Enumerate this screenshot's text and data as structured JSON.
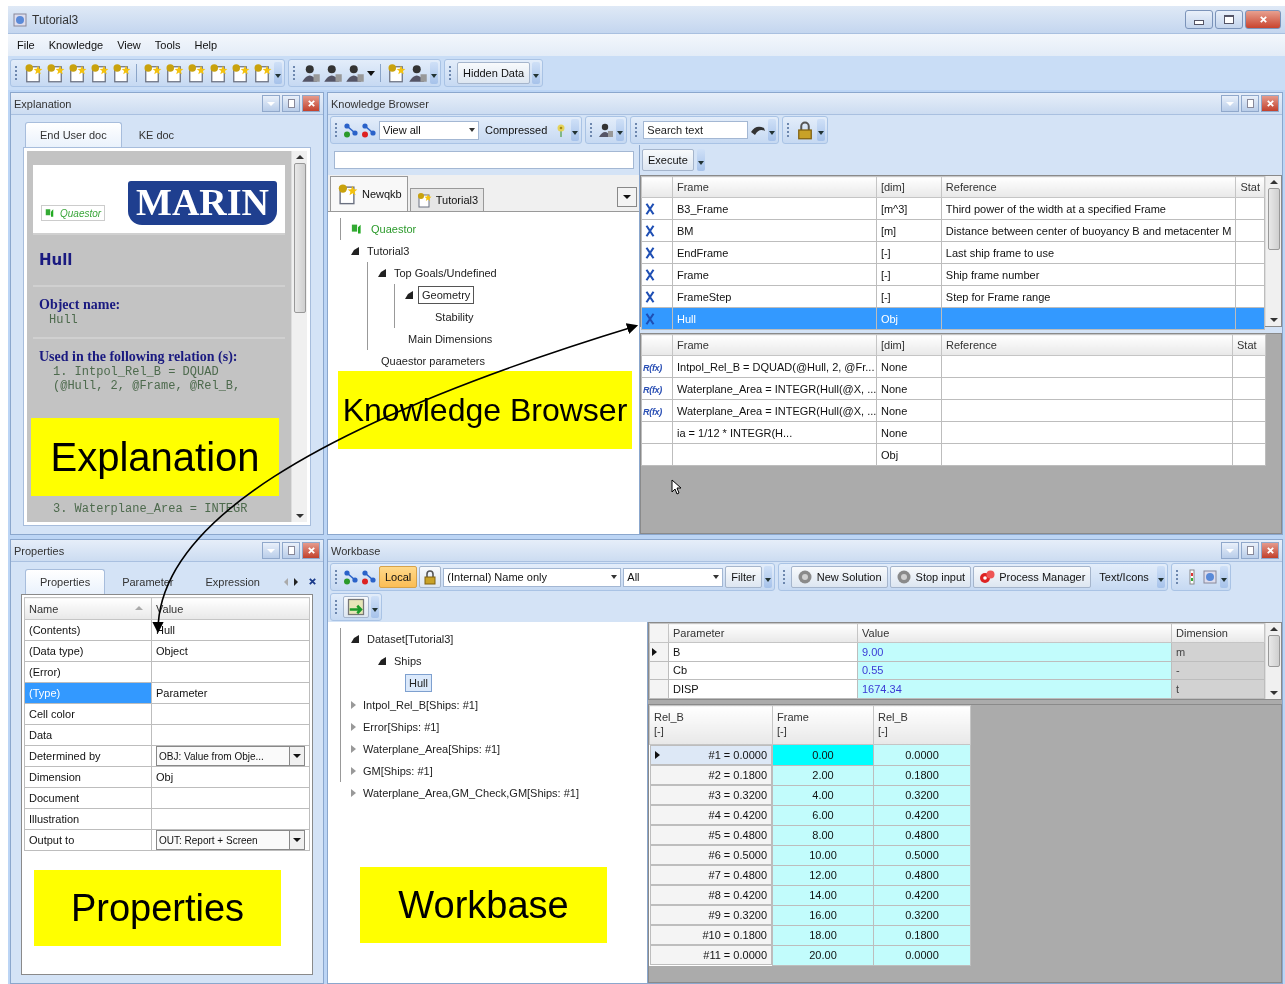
{
  "window": {
    "title": "Tutorial3"
  },
  "menu": [
    {
      "label": "File"
    },
    {
      "label": "Knowledge"
    },
    {
      "label": "View"
    },
    {
      "label": "Tools"
    },
    {
      "label": "Help"
    }
  ],
  "toolbar": {
    "hidden_data": "Hidden Data"
  },
  "explanation": {
    "title": "Explanation",
    "tabs": [
      {
        "label": "End User doc",
        "selected": true
      },
      {
        "label": "KE doc",
        "selected": false
      }
    ],
    "logo": {
      "brand": "MARIN",
      "product": "Quaestor"
    },
    "heading": "Hull",
    "object_name_label": "Object name:",
    "object_name": "Hull",
    "relations_label": "Used in the following relation (s):",
    "relations": [
      "1. Intpol_Rel_B = DQUAD",
      "(@Hull, 2, @Frame, @Rel_B,",
      "3. Waterplane_Area = INTEGR"
    ],
    "callout": "Explanation"
  },
  "knowledge_browser": {
    "title": "Knowledge Browser",
    "view": "View all",
    "compressed": "Compressed",
    "search": {
      "placeholder": "Search text"
    },
    "execute": "Execute",
    "kb_tabs": [
      {
        "label": "Newqkb",
        "selected": true
      },
      {
        "label": "Tutorial3",
        "selected": false
      }
    ],
    "tree": [
      {
        "label": "Quaestor",
        "kind": "library",
        "selected": false
      },
      {
        "label": "Tutorial3",
        "expanded": true,
        "selected": false,
        "children": [
          {
            "label": "Top Goals/Undefined",
            "expanded": true,
            "selected": false,
            "children": [
              {
                "label": "Geometry",
                "expanded": true,
                "selected": true,
                "children": [
                  {
                    "label": "Stability",
                    "selected": false
                  }
                ]
              },
              {
                "label": "Main Dimensions",
                "selected": false
              }
            ]
          },
          {
            "label": "Quaestor parameters",
            "selected": false
          }
        ]
      }
    ],
    "frames": {
      "columns": [
        "Frame",
        "[dim]",
        "Reference",
        "Stat"
      ],
      "rows": [
        {
          "name": "B3_Frame",
          "dim": "[m^3]",
          "reference": "Third power of the width at a specified Frame",
          "selected": false
        },
        {
          "name": "BM",
          "dim": "[m]",
          "reference": "Distance between center of buoyancy B and metacenter M",
          "selected": false
        },
        {
          "name": "EndFrame",
          "dim": "[-]",
          "reference": "Last ship frame to use",
          "selected": false
        },
        {
          "name": "Frame",
          "dim": "[-]",
          "reference": "Ship frame number",
          "selected": false
        },
        {
          "name": "FrameStep",
          "dim": "[-]",
          "reference": "Step for Frame range",
          "selected": false
        },
        {
          "name": "Hull",
          "dim": "Obj",
          "reference": "",
          "selected": true
        }
      ]
    },
    "relations": {
      "columns": [
        "Frame",
        "[dim]",
        "Reference",
        "Stat"
      ],
      "rows": [
        {
          "icon": "R(fx)",
          "name": "Intpol_Rel_B = DQUAD(@Hull, 2, @Fr...",
          "dim": "None"
        },
        {
          "icon": "R(fx)",
          "name": "Waterplane_Area = INTEGR(Hull(@X, ...",
          "dim": "None"
        },
        {
          "icon": "R(fx)",
          "name": "Waterplane_Area = INTEGR(Hull(@X, ...",
          "dim": "None"
        },
        {
          "name": "ia = 1/12 * INTEGR(H...",
          "dim": "None"
        },
        {
          "dim": "Obj"
        }
      ]
    },
    "callout": "Knowledge Browser"
  },
  "properties": {
    "title": "Properties",
    "tabs": [
      {
        "label": "Properties",
        "selected": true
      },
      {
        "label": "Parameter",
        "selected": false
      },
      {
        "label": "Expression",
        "selected": false
      }
    ],
    "columns": [
      "Name",
      "Value"
    ],
    "rows": [
      {
        "name": "(Contents)",
        "value": "Hull",
        "kind": "text",
        "selected": false
      },
      {
        "name": "(Data type)",
        "value": "Object",
        "kind": "text",
        "selected": false
      },
      {
        "name": "(Error)",
        "kind": "text",
        "selected": false
      },
      {
        "name": "(Type)",
        "value": "Parameter",
        "kind": "text",
        "selected": true
      },
      {
        "name": "Cell color",
        "kind": "text",
        "selected": false
      },
      {
        "name": "Data",
        "kind": "text",
        "selected": false
      },
      {
        "name": "Determined by",
        "value": "OBJ: Value from Obje...",
        "kind": "dropdown",
        "selected": false
      },
      {
        "name": "Dimension",
        "value": "Obj",
        "kind": "text",
        "selected": false
      },
      {
        "name": "Document",
        "kind": "text",
        "selected": false
      },
      {
        "name": "Illustration",
        "kind": "text",
        "selected": false
      },
      {
        "name": "Output to",
        "value": "OUT: Report + Screen",
        "kind": "dropdown",
        "selected": false
      }
    ],
    "callout": "Properties"
  },
  "workbase": {
    "title": "Workbase",
    "local": {
      "label": "Local",
      "on": true
    },
    "name_mode": "(Internal) Name only",
    "scope": "All",
    "filter": "Filter",
    "new_solution": "New Solution",
    "stop_input": "Stop input",
    "process_manager": "Process Manager",
    "text_icons": "Text/Icons",
    "tree": [
      {
        "label": "Dataset[Tutorial3]",
        "expanded": true,
        "selected": false,
        "children": [
          {
            "label": "Ships",
            "expanded": true,
            "selected": false,
            "children": [
              {
                "label": "Hull",
                "selected": true
              }
            ]
          }
        ]
      },
      {
        "label": "Intpol_Rel_B[Ships: #1]",
        "expanded": false,
        "selected": false
      },
      {
        "label": "Error[Ships: #1]",
        "expanded": false,
        "selected": false
      },
      {
        "label": "Waterplane_Area[Ships: #1]",
        "expanded": false,
        "selected": false
      },
      {
        "label": "GM[Ships: #1]",
        "expanded": false,
        "selected": false
      },
      {
        "label": "Waterplane_Area,GM_Check,GM[Ships: #1]",
        "expanded": false,
        "selected": false
      }
    ],
    "parameters": {
      "columns": [
        "Parameter",
        "Value",
        "Dimension"
      ],
      "rows": [
        {
          "name": "B",
          "value": "9.00",
          "dimension": "m",
          "current": true
        },
        {
          "name": "Cb",
          "value": "0.55",
          "dimension": "-",
          "current": false
        },
        {
          "name": "DISP",
          "value": "1674.34",
          "dimension": "t",
          "current": false
        }
      ]
    },
    "table": {
      "columns": [
        {
          "title": "Rel_B",
          "unit": "[-]"
        },
        {
          "title": "Frame",
          "unit": "[-]"
        },
        {
          "title": "Rel_B",
          "unit": "[-]"
        }
      ],
      "rows": [
        {
          "label": "#1 = 0.0000",
          "frame": "0.00",
          "rel_b": "0.0000",
          "current": true,
          "frame_selected": true
        },
        {
          "label": "#2 = 0.1800",
          "frame": "2.00",
          "rel_b": "0.1800",
          "current": false,
          "frame_selected": false
        },
        {
          "label": "#3 = 0.3200",
          "frame": "4.00",
          "rel_b": "0.3200",
          "current": false,
          "frame_selected": false
        },
        {
          "label": "#4 = 0.4200",
          "frame": "6.00",
          "rel_b": "0.4200",
          "current": false,
          "frame_selected": false
        },
        {
          "label": "#5 = 0.4800",
          "frame": "8.00",
          "rel_b": "0.4800",
          "current": false,
          "frame_selected": false
        },
        {
          "label": "#6 = 0.5000",
          "frame": "10.00",
          "rel_b": "0.5000",
          "current": false,
          "frame_selected": false
        },
        {
          "label": "#7 = 0.4800",
          "frame": "12.00",
          "rel_b": "0.4800",
          "current": false,
          "frame_selected": false
        },
        {
          "label": "#8 = 0.4200",
          "frame": "14.00",
          "rel_b": "0.4200",
          "current": false,
          "frame_selected": false
        },
        {
          "label": "#9 = 0.3200",
          "frame": "16.00",
          "rel_b": "0.3200",
          "current": false,
          "frame_selected": false
        },
        {
          "label": "#10 = 0.1800",
          "frame": "18.00",
          "rel_b": "0.1800",
          "current": false,
          "frame_selected": false
        },
        {
          "label": "#11 = 0.0000",
          "frame": "20.00",
          "rel_b": "0.0000",
          "current": false,
          "frame_selected": false
        }
      ]
    },
    "callout": "Workbase"
  }
}
